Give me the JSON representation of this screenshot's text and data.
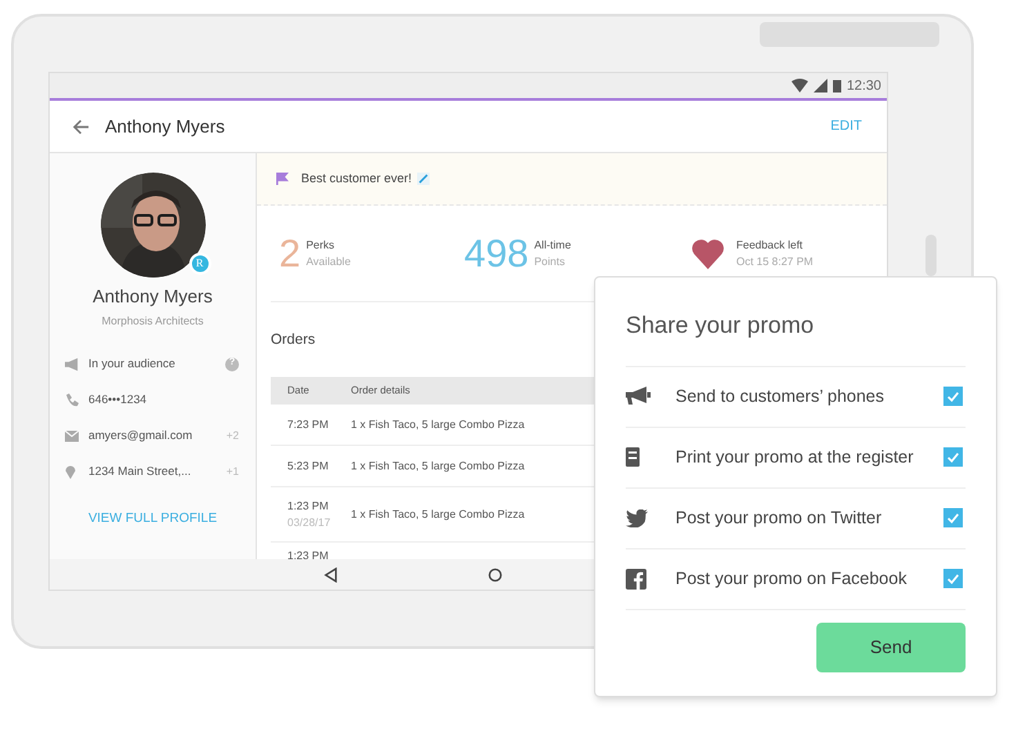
{
  "status_bar": {
    "time": "12:30"
  },
  "app_bar": {
    "title": "Anthony Myers",
    "action": "EDIT"
  },
  "profile": {
    "name": "Anthony Myers",
    "company": "Morphosis Architects",
    "badge": "R",
    "details": [
      {
        "kind": "audience",
        "text": "In your audience",
        "extra": "?"
      },
      {
        "kind": "phone",
        "text": "646•••1234"
      },
      {
        "kind": "email",
        "text": "amyers@gmail.com",
        "extra": "+2"
      },
      {
        "kind": "address",
        "text": "1234 Main Street,...",
        "extra": "+1"
      }
    ],
    "link": "VIEW FULL PROFILE"
  },
  "note": {
    "text": "Best customer ever!"
  },
  "stats": [
    {
      "kind": "number",
      "value": "2",
      "label": "Perks",
      "sub": "Available",
      "color": "#eab59a"
    },
    {
      "kind": "number",
      "value": "498",
      "label": "All-time",
      "sub": "Points",
      "color": "#6cc3e6"
    },
    {
      "kind": "heart",
      "label": "Feedback left",
      "sub": "Oct 15 8:27 PM",
      "color": "#b85567"
    }
  ],
  "orders": {
    "title": "Orders",
    "columns": [
      "Date",
      "Order details"
    ],
    "rows": [
      {
        "date": "7:23 PM",
        "details": "1 x Fish Taco, 5 large Combo Pizza"
      },
      {
        "date": "5:23 PM",
        "details": "1 x Fish Taco, 5 large Combo Pizza"
      },
      {
        "date": "1:23 PM",
        "subdate": "03/28/17",
        "details": "1 x Fish Taco, 5 large Combo Pizza"
      },
      {
        "date": "1:23 PM"
      }
    ]
  },
  "share_dialog": {
    "title": "Share your promo",
    "options": [
      {
        "kind": "megaphone",
        "label": "Send to customers’ phones",
        "checked": true
      },
      {
        "kind": "register",
        "label": "Print your promo at the register",
        "checked": true
      },
      {
        "kind": "twitter",
        "label": "Post your promo on Twitter",
        "checked": true
      },
      {
        "kind": "facebook",
        "label": "Post your promo on Facebook",
        "checked": true
      }
    ],
    "button": "Send"
  }
}
